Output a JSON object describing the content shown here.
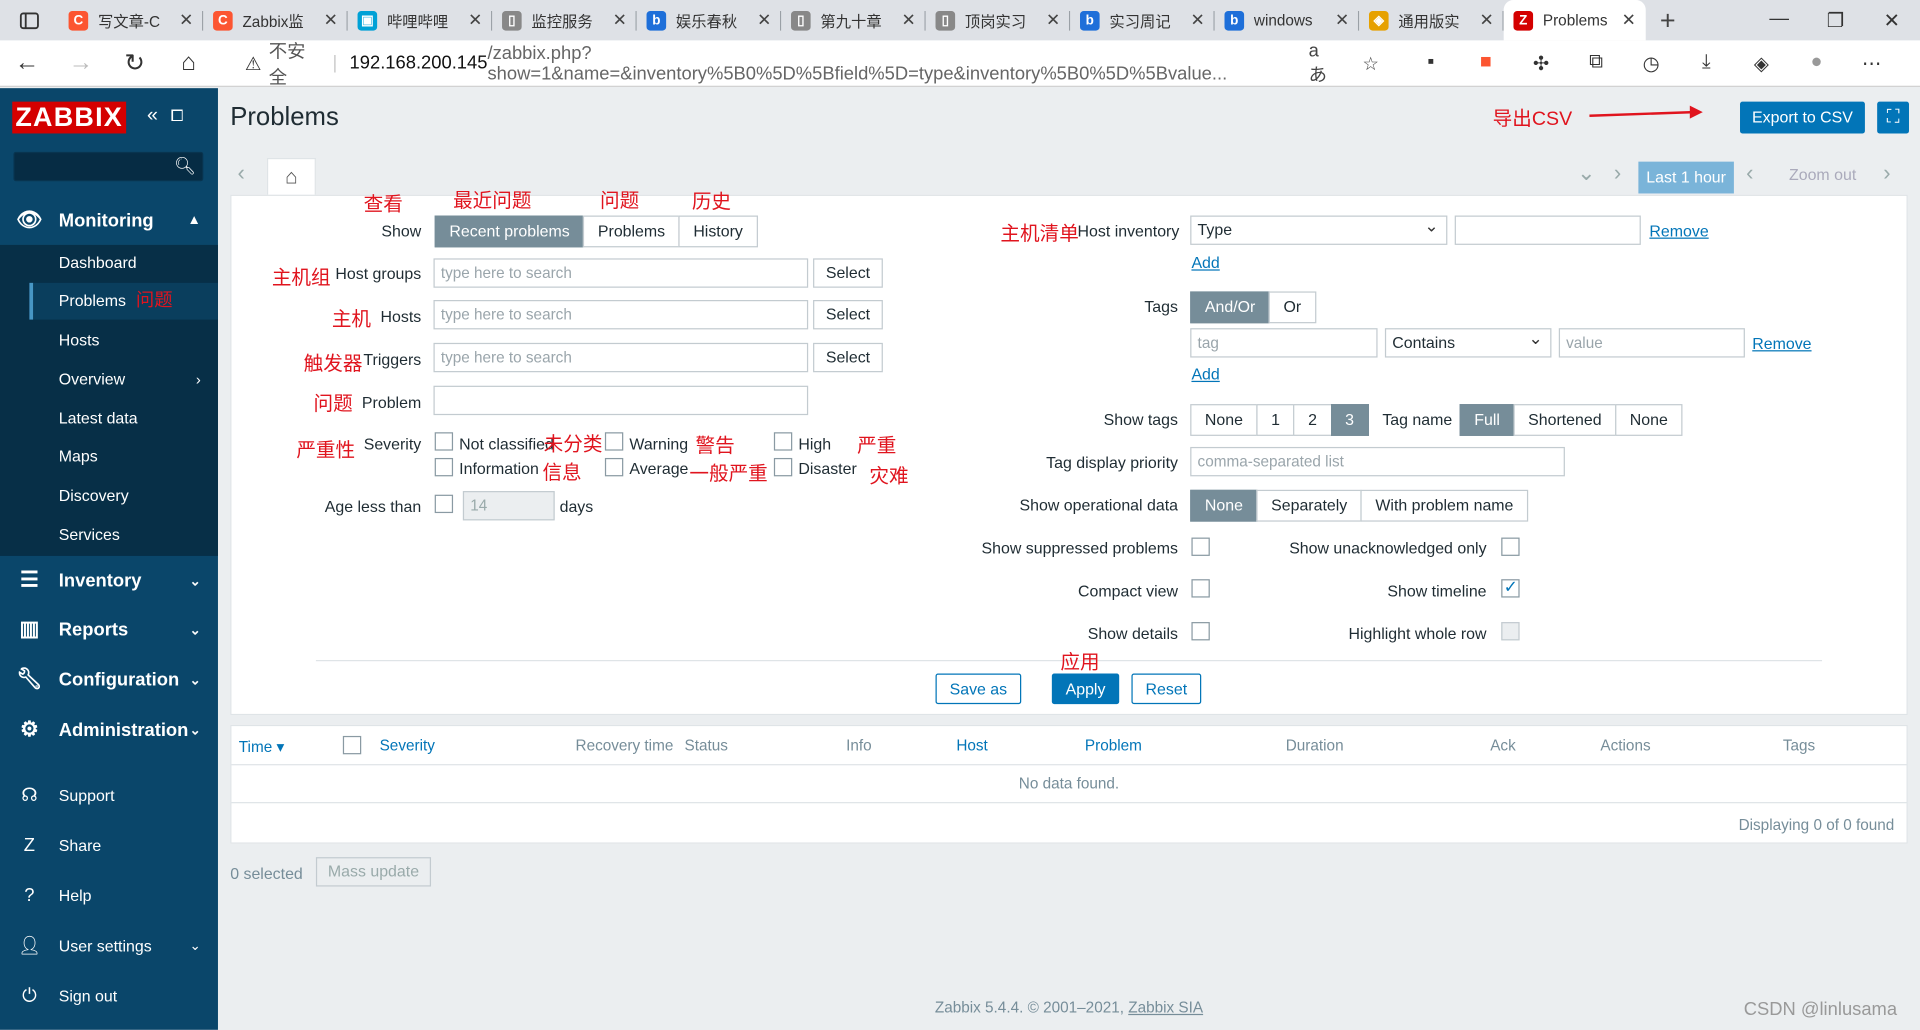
{
  "browser": {
    "tabs": [
      {
        "title": "写文章-C",
        "fav": "C",
        "color": "#fc5531"
      },
      {
        "title": "Zabbix监",
        "fav": "C",
        "color": "#fc5531"
      },
      {
        "title": "哔哩哔哩",
        "fav": "▣",
        "color": "#00a1d6"
      },
      {
        "title": "监控服务",
        "fav": "▯",
        "color": "#888888"
      },
      {
        "title": "娱乐春秋",
        "fav": "b",
        "color": "#1e6fd9"
      },
      {
        "title": "第九十章",
        "fav": "▯",
        "color": "#888888"
      },
      {
        "title": "顶岗实习",
        "fav": "▯",
        "color": "#888888"
      },
      {
        "title": "实习周记",
        "fav": "b",
        "color": "#1e6fd9"
      },
      {
        "title": "windows",
        "fav": "b",
        "color": "#1e6fd9"
      },
      {
        "title": "通用版实",
        "fav": "◈",
        "color": "#e6a100"
      }
    ],
    "active_tab": {
      "title": "Problems",
      "fav": "Z",
      "color": "#d40000"
    },
    "url_insecure": "不安全",
    "url_host": "192.168.200.145",
    "url_path": "/zabbix.php?show=1&name=&inventory%5B0%5D%5Bfield%5D=type&inventory%5B0%5D%5Bvalue..."
  },
  "sidebar": {
    "logo": "ZABBIX",
    "monitoring": "Monitoring",
    "sub": [
      "Dashboard",
      "Problems",
      "Hosts",
      "Overview",
      "Latest data",
      "Maps",
      "Discovery",
      "Services"
    ],
    "inventory": "Inventory",
    "reports": "Reports",
    "configuration": "Configuration",
    "administration": "Administration",
    "support": "Support",
    "share": "Share",
    "help": "Help",
    "user_settings": "User settings",
    "sign_out": "Sign out"
  },
  "header": {
    "title": "Problems",
    "export": "Export to CSV"
  },
  "timebar": {
    "last": "Last 1 hour",
    "zoom_out": "Zoom out"
  },
  "filter": {
    "show_label": "Show",
    "show_options": [
      "Recent problems",
      "Problems",
      "History"
    ],
    "host_groups_label": "Host groups",
    "hosts_label": "Hosts",
    "triggers_label": "Triggers",
    "problem_label": "Problem",
    "severity_label": "Severity",
    "age_label": "Age less than",
    "age_value": "14",
    "age_unit": "days",
    "placeholder": "type here to search",
    "select": "Select",
    "severities": [
      "Not classified",
      "Warning",
      "High",
      "Information",
      "Average",
      "Disaster"
    ],
    "host_inventory_label": "Host inventory",
    "inventory_field": "Type",
    "remove": "Remove",
    "add": "Add",
    "tags_label": "Tags",
    "tags_ops": [
      "And/Or",
      "Or"
    ],
    "tag_placeholder": "tag",
    "tag_operator": "Contains",
    "value_placeholder": "value",
    "show_tags_label": "Show tags",
    "show_tags_opts": [
      "None",
      "1",
      "2",
      "3"
    ],
    "tag_name_label": "Tag name",
    "tag_name_opts": [
      "Full",
      "Shortened",
      "None"
    ],
    "tag_priority_label": "Tag display priority",
    "tag_priority_placeholder": "comma-separated list",
    "op_data_label": "Show operational data",
    "op_data_opts": [
      "None",
      "Separately",
      "With problem name"
    ],
    "suppressed_label": "Show suppressed problems",
    "unack_label": "Show unacknowledged only",
    "compact_label": "Compact view",
    "timeline_label": "Show timeline",
    "details_label": "Show details",
    "highlight_label": "Highlight whole row",
    "save_as": "Save as",
    "apply": "Apply",
    "reset": "Reset"
  },
  "table": {
    "cols": [
      "Time ▾",
      "Severity",
      "Recovery time",
      "Status",
      "Info",
      "Host",
      "Problem",
      "Duration",
      "Ack",
      "Actions",
      "Tags"
    ],
    "no_data": "No data found.",
    "displaying": "Displaying 0 of 0 found"
  },
  "bottom": {
    "selected": "0 selected",
    "mass_update": "Mass update"
  },
  "footer": {
    "text": "Zabbix 5.4.4. © 2001–2021, ",
    "link": "Zabbix SIA"
  },
  "annotations": {
    "export": "导出CSV",
    "view": "查看",
    "recent": "最近问题",
    "problems": "问题",
    "history": "历史",
    "inventory": "主机清单",
    "host_groups": "主机组",
    "hosts": "主机",
    "triggers": "触发器",
    "problem": "问题",
    "severity": "严重性",
    "not_classified": "未分类",
    "warning": "警告",
    "high": "严重",
    "information": "信息",
    "average": "一般严重",
    "disaster": "灾难",
    "apply": "应用",
    "sidebar_problems": "问题"
  },
  "watermark": "CSDN @linlusama"
}
